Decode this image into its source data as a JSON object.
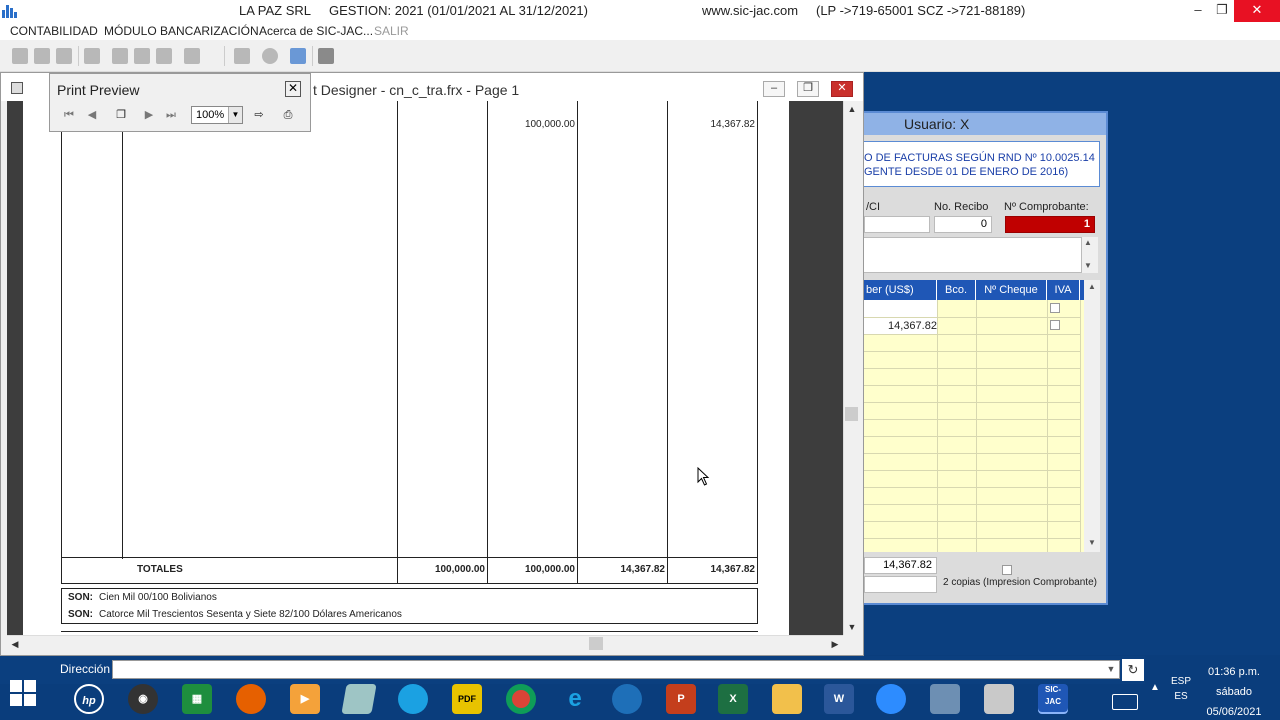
{
  "app": {
    "company": "LA PAZ SRL",
    "gestion": "GESTION: 2021  (01/01/2021 AL 31/12/2021)",
    "website": "www.sic-jac.com",
    "phones": "(LP ->719-65001  SCZ ->721-88189)"
  },
  "menu": {
    "contabilidad": "CONTABILIDAD",
    "bancarizacion": "MÓDULO BANCARIZACIÓN",
    "acerca": "Acerca de SIC-JAC...",
    "salir": "SALIR"
  },
  "designer": {
    "title": "t Designer - cn_c_tra.frx - Page 1"
  },
  "print_preview": {
    "title": "Print Preview",
    "zoom": "100%"
  },
  "report": {
    "top_values": [
      "100,000.00",
      "14,367.82"
    ],
    "totals_label": "TOTALES",
    "totals": [
      "100,000.00",
      "100,000.00",
      "14,367.82",
      "14,367.82"
    ],
    "son_label": "SON:",
    "son_line1": "Cien Mil  00/100 Bolivianos",
    "son_line2": "Catorce Mil Trescientos Sesenta y Siete  82/100 Dólares Americanos"
  },
  "form": {
    "title": "Usuario: X",
    "banner_line1": "O DE FACTURAS SEGÚN RND Nº 10.0025.14",
    "banner_line2": "GENTE DESDE 01 DE ENERO DE 2016)",
    "label_nit": "/CI",
    "label_recibo": "No. Recibo",
    "recibo_value": "0",
    "label_comprobante": "Nº Comprobante:",
    "comprobante_value": "1",
    "grid_headers": [
      "ber (US$)",
      "Bco.",
      "Nº Cheque",
      "IVA"
    ],
    "grid_row2_value": "14,367.82",
    "total_value": "14,367.82",
    "copias_label": "2 copias (Impresion Comprobante)"
  },
  "addressbar": {
    "label": "Dirección"
  },
  "taskbar": {
    "lang_top": "ESP",
    "lang_bottom": "ES",
    "time": "01:36 p.m.",
    "day": "sábado",
    "date": "05/06/2021",
    "apps": [
      "hp",
      "camera",
      "sheets",
      "firefox",
      "video",
      "notepad",
      "edge",
      "pdf",
      "chrome",
      "ie",
      "speed",
      "powerpoint",
      "excel",
      "explorer",
      "word",
      "zoom",
      "remote",
      "paint",
      "sic-jac"
    ]
  },
  "colors": {
    "desktop": "#0b3f7f",
    "grid_header": "#1f57b6",
    "grid_body": "#ffffcc",
    "comprobante": "#c00000",
    "close_red": "#e81123"
  }
}
